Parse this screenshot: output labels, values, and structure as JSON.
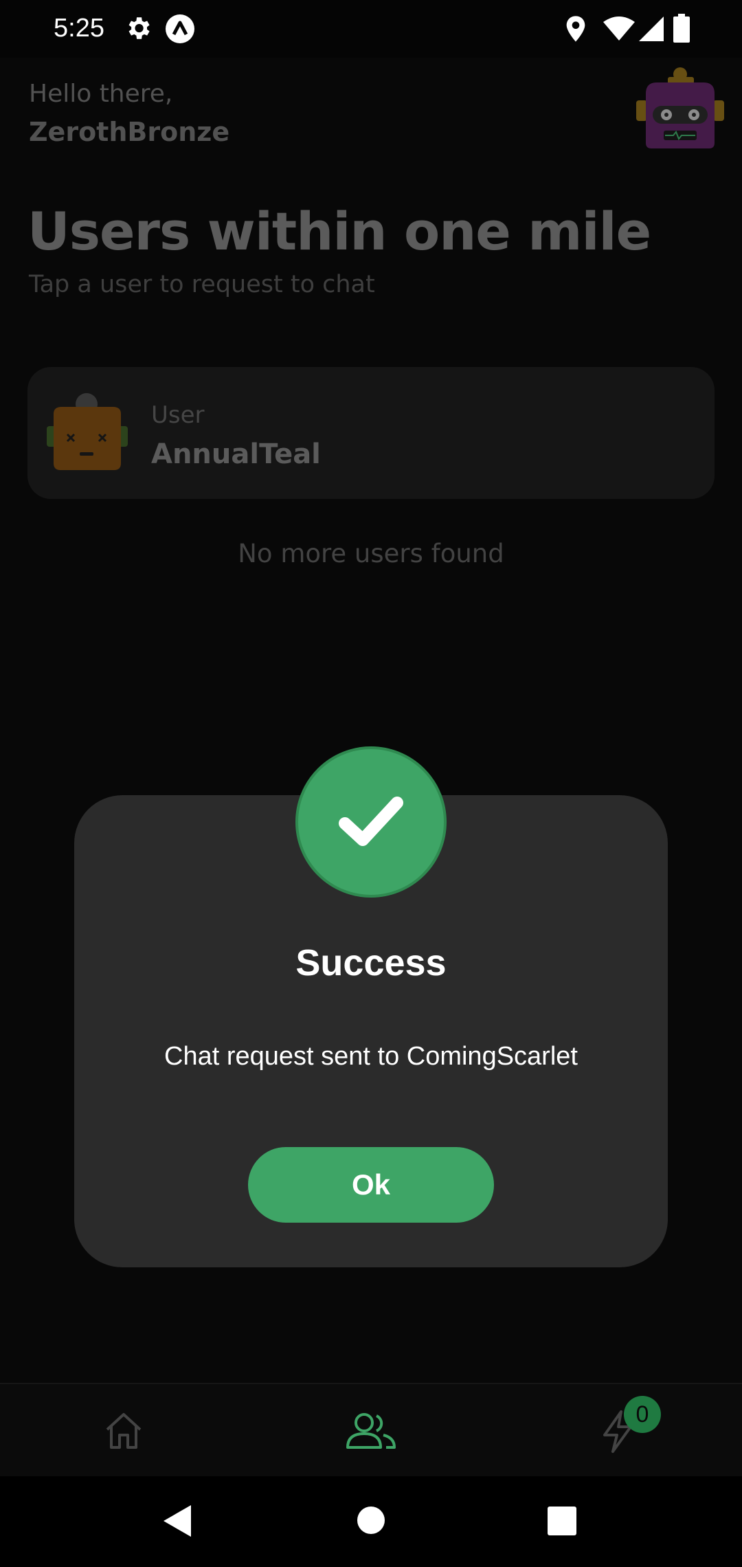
{
  "status_bar": {
    "time": "5:25",
    "left_icons": [
      "gear-icon",
      "a-logo-icon"
    ],
    "right_icons": [
      "location-icon",
      "wifi-icon",
      "signal-icon",
      "battery-icon"
    ]
  },
  "header": {
    "greeting": "Hello there,",
    "username": "ZerothBronze"
  },
  "main": {
    "title": "Users within one mile",
    "subtitle": "Tap a user to request to chat",
    "users": [
      {
        "kind": "User",
        "name": "AnnualTeal"
      }
    ],
    "empty_text": "No more users found"
  },
  "dialog": {
    "title": "Success",
    "message": "Chat request sent to ComingScarlet",
    "ok_label": "Ok"
  },
  "bottom_nav": {
    "items": [
      "home-icon",
      "users-icon",
      "lightning-icon"
    ],
    "active": "users-icon",
    "badge_count": "0"
  },
  "colors": {
    "accent": "#3ea566",
    "dialog_bg": "#2b2b2b",
    "background": "#0b0b0b"
  }
}
